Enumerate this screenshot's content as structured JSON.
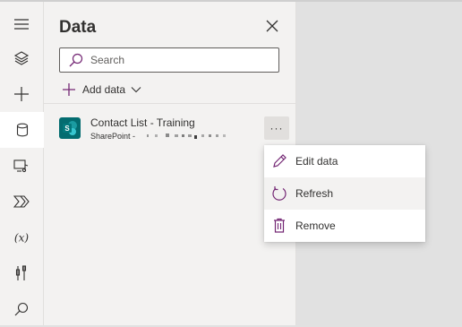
{
  "rail": {
    "items": [
      {
        "icon": "hamburger-menu-icon"
      },
      {
        "icon": "layers-icon"
      },
      {
        "icon": "plus-icon"
      },
      {
        "icon": "database-icon",
        "active": true
      },
      {
        "icon": "media-icon"
      },
      {
        "icon": "power-automate-icon"
      },
      {
        "icon": "variables-icon"
      },
      {
        "icon": "tools-icon"
      },
      {
        "icon": "search-icon"
      }
    ]
  },
  "panel": {
    "title": "Data",
    "search_placeholder": "Search",
    "add_data_label": "Add data"
  },
  "data_sources": [
    {
      "name": "Contact List - Training",
      "subtitle": "SharePoint -",
      "more_label": "···"
    }
  ],
  "context_menu": {
    "items": [
      {
        "label": "Edit data",
        "icon": "edit-icon"
      },
      {
        "label": "Refresh",
        "icon": "refresh-icon"
      },
      {
        "label": "Remove",
        "icon": "trash-icon"
      }
    ]
  },
  "colors": {
    "accent": "#742774",
    "sharepoint": "#036c70"
  }
}
